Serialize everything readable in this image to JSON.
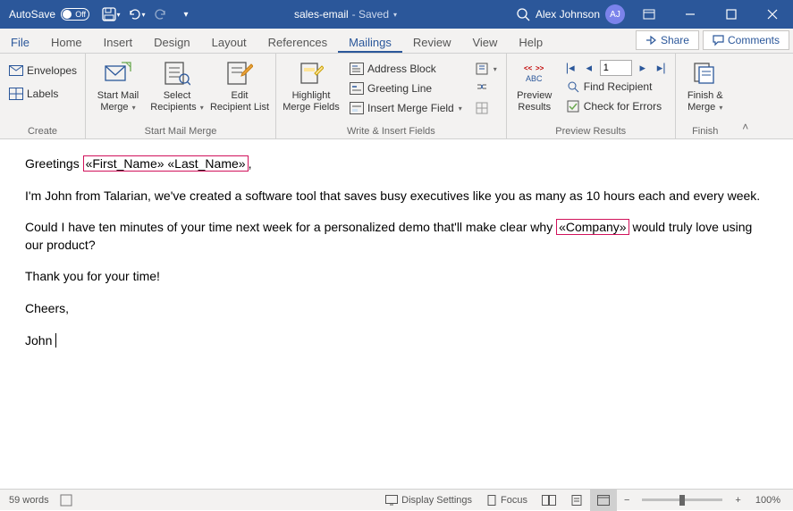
{
  "titlebar": {
    "autosave_label": "AutoSave",
    "autosave_off": "Off",
    "doc_name": "sales-email",
    "saved_state": " - Saved",
    "user_name": "Alex Johnson",
    "user_initials": "AJ"
  },
  "tabs": {
    "file": "File",
    "home": "Home",
    "insert": "Insert",
    "design": "Design",
    "layout": "Layout",
    "references": "References",
    "mailings": "Mailings",
    "review": "Review",
    "view": "View",
    "help": "Help",
    "share": "Share",
    "comments": "Comments"
  },
  "ribbon": {
    "create": {
      "label": "Create",
      "envelopes": "Envelopes",
      "labels": "Labels"
    },
    "start": {
      "label": "Start Mail Merge",
      "start_mail": "Start Mail\nMerge",
      "select_recip": "Select\nRecipients",
      "edit_recip": "Edit\nRecipient List"
    },
    "write": {
      "label": "Write & Insert Fields",
      "highlight": "Highlight\nMerge Fields",
      "address": "Address Block",
      "greeting": "Greeting Line",
      "insert_field": "Insert Merge Field"
    },
    "preview": {
      "label": "Preview Results",
      "abc": "ABC",
      "preview": "Preview\nResults",
      "record": "1",
      "find": "Find Recipient",
      "check": "Check for Errors"
    },
    "finish": {
      "label": "Finish",
      "finish_merge": "Finish &\nMerge"
    }
  },
  "document": {
    "p1_a": "Greetings ",
    "p1_merge": "«First_Name» «Last_Name»",
    "p1_b": ",",
    "p2": "I'm John from Talarian, we've created a software tool that saves busy executives like you as many as 10 hours each and every week.",
    "p3_a": "Could I have ten minutes of your time next week for a personalized demo that'll make clear why ",
    "p3_merge": "«Company»",
    "p3_b": " would truly love using our product?",
    "p4": "Thank you for your time!",
    "p5": "Cheers,",
    "p6": "John"
  },
  "status": {
    "words": "59 words",
    "display": "Display Settings",
    "focus": "Focus",
    "zoom": "100%"
  }
}
